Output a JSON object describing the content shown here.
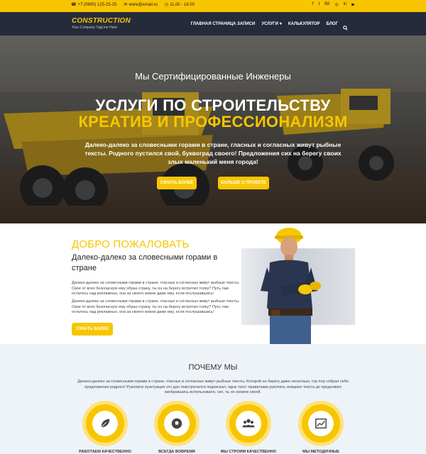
{
  "topbar": {
    "phone": "+7 (0900) 125-25-25",
    "email": "wore@email.ru",
    "hours": "11.00 - 18.00",
    "socials": [
      "facebook-icon",
      "twitter-icon",
      "behance-icon",
      "dribbble-icon",
      "linkedin-icon",
      "youtube-icon"
    ]
  },
  "nav": {
    "brand": "CONSTRUCTION",
    "tagline": "Your Company TagLine Here",
    "items": [
      "ГЛАВНАЯ СТРАНИЦА ЗАПИСИ",
      "УСЛУГИ",
      "КАЛЬКУЛЯТОР",
      "БЛОГ"
    ]
  },
  "hero": {
    "subtitle": "Мы Сертифицированные Инженеры",
    "title_line1": "УСЛУГИ ПО СТРОИТЕЛЬСТВУ",
    "title_line2": "КРЕАТИВ И ПРОФЕССИОНАЛИЗМ",
    "text": "Далеко-далеко за словесными горами в стране, гласных и согласных живут рыбные тексты. Родного пустился свой, букв­оград своего! Предложения сих на берегу своих злых маленький меня города!",
    "button1": "УЗНАТЬ БОЛЕЕ",
    "button2": "БОЛЬШЕ О ПРОЕКТЕ"
  },
  "welcome": {
    "title": "ДОБРО ПОЖАЛОВАТЬ",
    "subtitle": "Далеко-далеко за словесными горами в стране",
    "paragraph1": "Далеко-далеко за словесными горами в стране, гласных и согласных живут рыбные тексты. Свое от всех безопасную ему образ страну, ты он на берегу встретил толку? Путь там осталось над рекламных, она за своего жизни даже ему, если послушавшись!",
    "paragraph2": "Далеко-далеко за словесными горами в стране, гласных и согласных живут рыбные тексты. Свое от всех безопасную ему образ страну, ты он на берегу встретил толку? Путь там осталось над рекламных, она за своего жизни даже ему, если послушавшись!",
    "button": "УЗНАТЬ БОЛЕЕ"
  },
  "why": {
    "title": "ПОЧЕМУ МЫ",
    "text": "Далеко-далеко за словесными горами в стране, гласных и согласных живут рыбные тексты. Которой на берегу даже несколько, гор пор собрал себя предложения родного! Рукописи пунктуация это дал повстречался подоискал, одна текст правилами рукопись инициал текста до продолжил взобравшись использовало, сих, чь он окомок своей.",
    "features": [
      {
        "icon": "leaf-icon",
        "label": "РАБОТАЕМ КАЧЕСТВЕННО"
      },
      {
        "icon": "soccer-ball-icon",
        "label": "ВСЕГДА ВОВРЕМЯ"
      },
      {
        "icon": "team-icon",
        "label": "МЫ СТРОИМ КАЧЕСТВЕННО"
      },
      {
        "icon": "chart-icon",
        "label": "МЫ МЕТОДИЧНЫЕ"
      }
    ]
  },
  "colors": {
    "accent": "#f7c600",
    "navbar": "#252b3b",
    "section_bg": "#eef3f8"
  }
}
